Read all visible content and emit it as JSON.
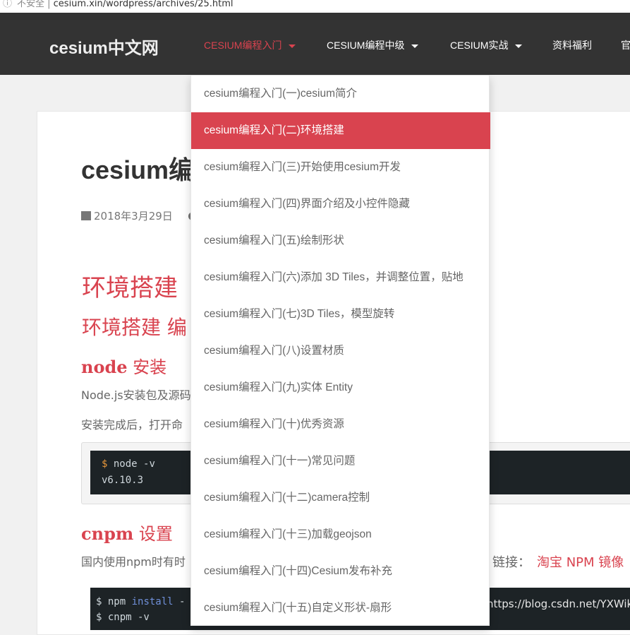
{
  "browser": {
    "address_icon": "info-icon",
    "address_prefix": "不安全 |",
    "address_text": "cesium.xin/wordpress/archives/25.html"
  },
  "header": {
    "logo": "cesium中文网",
    "menu": [
      {
        "label": "CESIUM编程入门",
        "active": true,
        "has_caret": true
      },
      {
        "label": "CESIUM编程中级",
        "active": false,
        "has_caret": true
      },
      {
        "label": "CESIUM实战",
        "active": false,
        "has_caret": true
      },
      {
        "label": "资料福利",
        "active": false,
        "has_caret": false
      },
      {
        "label": "官",
        "active": false,
        "has_caret": false
      }
    ]
  },
  "dropdown": {
    "items": [
      {
        "label": "cesium编程入门(一)cesium简介"
      },
      {
        "label": "cesium编程入门(二)环境搭建",
        "active": true
      },
      {
        "label": "cesium编程入门(三)开始使用cesium开发"
      },
      {
        "label": "cesium编程入门(四)界面介绍及小控件隐藏"
      },
      {
        "label": "cesium编程入门(五)绘制形状"
      },
      {
        "label": "cesium编程入门(六)添加 3D Tiles，并调整位置，贴地"
      },
      {
        "label": "cesium编程入门(七)3D Tiles，模型旋转"
      },
      {
        "label": "cesium编程入门(八)设置材质"
      },
      {
        "label": "cesium编程入门(九)实体 Entity"
      },
      {
        "label": "cesium编程入门(十)优秀资源"
      },
      {
        "label": "cesium编程入门(十一)常见问题"
      },
      {
        "label": "cesium编程入门(十二)camera控制"
      },
      {
        "label": "cesium编程入门(十三)加载geojson"
      },
      {
        "label": "cesium编程入门(十四)Cesium发布补充"
      },
      {
        "label": "cesium编程入门(十五)自定义形状-扇形"
      }
    ]
  },
  "article": {
    "title": "cesium编",
    "date": "2018年3月29日",
    "h1": "环境搭建",
    "h2": "环境搭建 编",
    "section1_title_bold": "node",
    "section1_title_rest": " 安装",
    "para1": "Node.js安装包及源码",
    "para2": "安装完成后，打开命",
    "code1_prompt": "$",
    "code1_cmd": " node -v",
    "code1_output": "v6.10.3",
    "section2_title_bold": "cnpm",
    "section2_title_rest": " 设置",
    "para3": "国内使用npm时有时",
    "para3_tail": "，链接：",
    "mirror_link": "淘宝 NPM 镜像",
    "code2_line1_prompt": "$ npm",
    "code2_line1_kw": " install",
    "code2_line1_rest": " -",
    "code2_line2": "$ cnpm -v",
    "watermark": "https://blog.csdn.net/YXWik"
  }
}
